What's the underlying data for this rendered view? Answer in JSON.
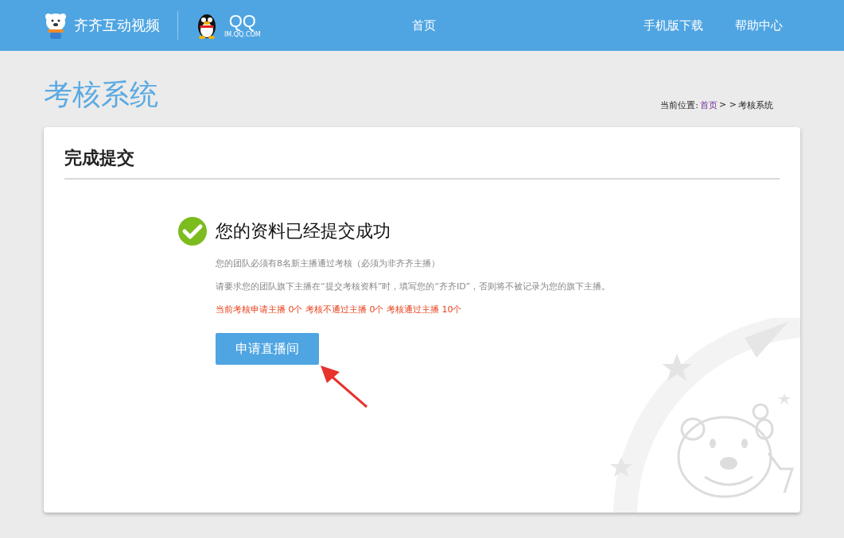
{
  "header": {
    "brand": "齐齐互动视频",
    "partner_logo": "QQ",
    "partner_domain": "IM.QQ.COM",
    "nav": [
      {
        "label": "首页"
      }
    ],
    "nav_right": [
      {
        "label": "手机版下载"
      },
      {
        "label": "帮助中心"
      }
    ]
  },
  "page_title": "考核系统",
  "breadcrumb": {
    "label": "当前位置:",
    "link": "首页",
    "separator": "> >",
    "current": "考核系统"
  },
  "card": {
    "title": "完成提交",
    "success_title": "您的资料已经提交成功",
    "notes": [
      {
        "text": "您的团队必须有8名新主播通过考核（必须为非齐齐主播）",
        "kind": "hint"
      },
      {
        "text": "请要求您的团队旗下主播在“提交考核资料”时，填写您的“齐齐ID”，否则将不被记录为您的旗下主播。",
        "kind": "hint"
      },
      {
        "text": "当前考核申请主播 0个 考核不通过主播 0个 考核通过主播 10个",
        "kind": "stats"
      }
    ],
    "button": "申请直播间"
  }
}
